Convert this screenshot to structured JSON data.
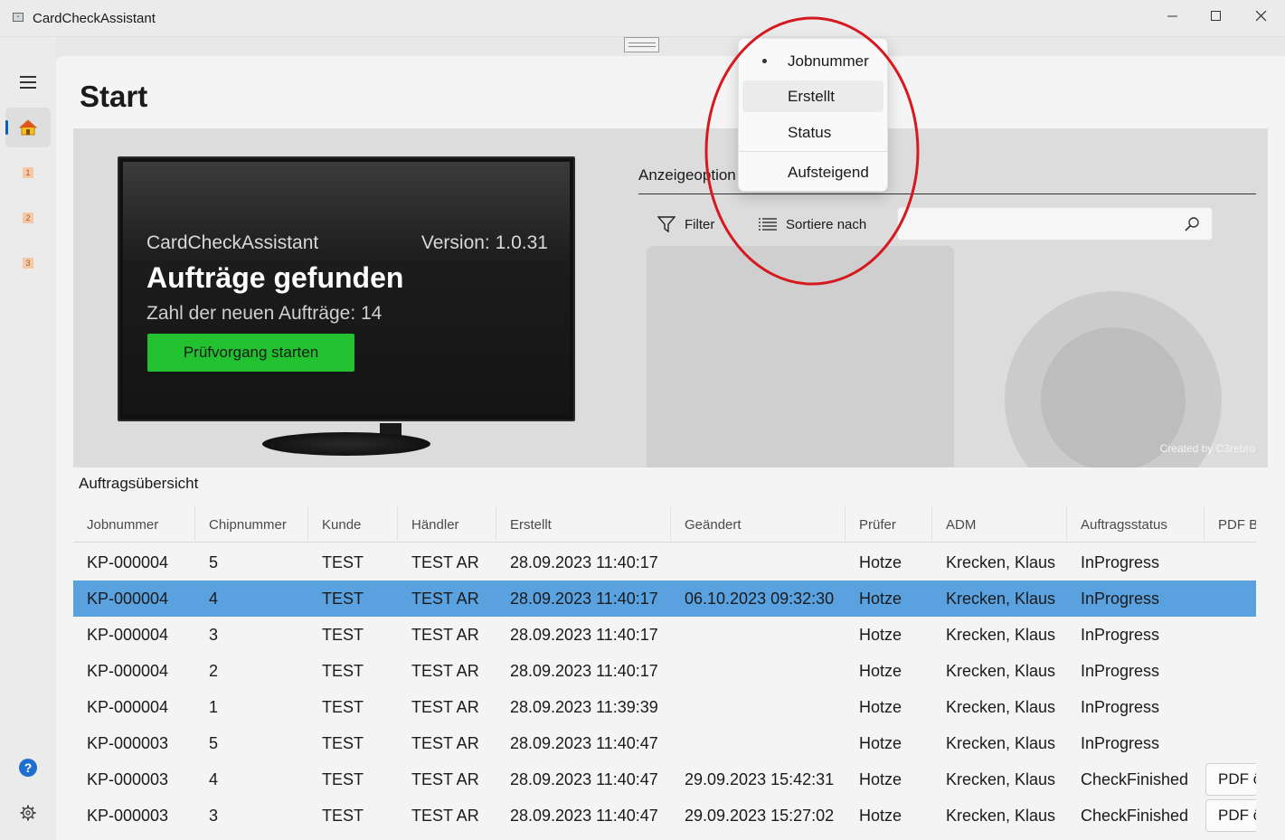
{
  "window": {
    "title": "CardCheckAssistant",
    "minimize_icon": "minimize-icon",
    "maximize_icon": "maximize-icon",
    "close_icon": "close-icon"
  },
  "nav": {
    "menu_icon": "hamburger-icon",
    "items": [
      {
        "icon": "home-icon",
        "active": true
      },
      {
        "icon": "step-1-icon",
        "label": "1"
      },
      {
        "icon": "step-2-icon",
        "label": "2"
      },
      {
        "icon": "step-3-icon",
        "label": "3"
      }
    ],
    "help_label": "?",
    "settings_icon": "gear-icon"
  },
  "page": {
    "title": "Start"
  },
  "hero": {
    "app_name": "CardCheckAssistant",
    "version": "Version: 1.0.31",
    "headline": "Aufträge gefunden",
    "subline": "Zahl der neuen Aufträge: 14",
    "start_button": "Prüfvorgang starten",
    "watermark": "Created by C3rebro"
  },
  "options": {
    "label": "Anzeigeoption",
    "filter_label": "Filter",
    "sort_label": "Sortiere nach",
    "search_value": "",
    "search_placeholder": ""
  },
  "sort_menu": {
    "items": [
      "Jobnummer",
      "Erstellt",
      "Status"
    ],
    "selected": "Jobnummer",
    "hovered": "Erstellt",
    "order_item": "Aufsteigend"
  },
  "table": {
    "section_label": "Auftragsübersicht",
    "columns": [
      "Jobnummer",
      "Chipnummer",
      "Kunde",
      "Händler",
      "Erstellt",
      "Geändert",
      "Prüfer",
      "ADM",
      "Auftragsstatus",
      "PDF Bericht"
    ],
    "rows": [
      {
        "job": "KP-000004",
        "chip": "5",
        "kunde": "TEST",
        "haendler": "TEST AR",
        "erstellt": "28.09.2023 11:40:17",
        "geaendert": "",
        "pruefer": "Hotze",
        "adm": "Krecken, Klaus",
        "status": "InProgress",
        "pdf": ""
      },
      {
        "job": "KP-000004",
        "chip": "4",
        "kunde": "TEST",
        "haendler": "TEST AR",
        "erstellt": "28.09.2023 11:40:17",
        "geaendert": "06.10.2023 09:32:30",
        "pruefer": "Hotze",
        "adm": "Krecken, Klaus",
        "status": "InProgress",
        "pdf": "",
        "selected": true
      },
      {
        "job": "KP-000004",
        "chip": "3",
        "kunde": "TEST",
        "haendler": "TEST AR",
        "erstellt": "28.09.2023 11:40:17",
        "geaendert": "",
        "pruefer": "Hotze",
        "adm": "Krecken, Klaus",
        "status": "InProgress",
        "pdf": ""
      },
      {
        "job": "KP-000004",
        "chip": "2",
        "kunde": "TEST",
        "haendler": "TEST AR",
        "erstellt": "28.09.2023 11:40:17",
        "geaendert": "",
        "pruefer": "Hotze",
        "adm": "Krecken, Klaus",
        "status": "InProgress",
        "pdf": ""
      },
      {
        "job": "KP-000004",
        "chip": "1",
        "kunde": "TEST",
        "haendler": "TEST AR",
        "erstellt": "28.09.2023 11:39:39",
        "geaendert": "",
        "pruefer": "Hotze",
        "adm": "Krecken, Klaus",
        "status": "InProgress",
        "pdf": ""
      },
      {
        "job": "KP-000003",
        "chip": "5",
        "kunde": "TEST",
        "haendler": "TEST AR",
        "erstellt": "28.09.2023 11:40:47",
        "geaendert": "",
        "pruefer": "Hotze",
        "adm": "Krecken, Klaus",
        "status": "InProgress",
        "pdf": ""
      },
      {
        "job": "KP-000003",
        "chip": "4",
        "kunde": "TEST",
        "haendler": "TEST AR",
        "erstellt": "28.09.2023 11:40:47",
        "geaendert": "29.09.2023 15:42:31",
        "pruefer": "Hotze",
        "adm": "Krecken, Klaus",
        "status": "CheckFinished",
        "pdf": "PDF öffnen"
      },
      {
        "job": "KP-000003",
        "chip": "3",
        "kunde": "TEST",
        "haendler": "TEST AR",
        "erstellt": "28.09.2023 11:40:47",
        "geaendert": "29.09.2023 15:27:02",
        "pruefer": "Hotze",
        "adm": "Krecken, Klaus",
        "status": "CheckFinished",
        "pdf": "PDF öffnen"
      }
    ]
  },
  "colors": {
    "accent": "#0a5fb4",
    "selected_row": "#5aa1e0",
    "start_button": "#22c12f",
    "annotation": "#d6181f"
  }
}
